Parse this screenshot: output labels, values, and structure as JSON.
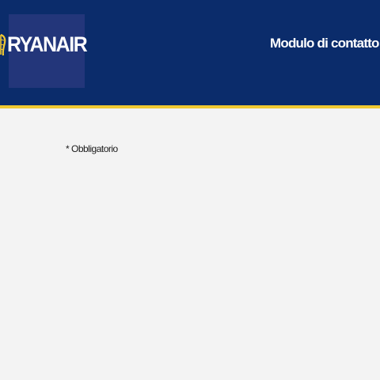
{
  "header": {
    "logo_text": "RYANAIR",
    "title": "Modulo di contatto"
  },
  "form": {
    "required_note": "* Obbligatorio"
  },
  "colors": {
    "header_background": "#0b2c6b",
    "logo_background": "#23367a",
    "accent_stripe": "#f1c931",
    "page_background": "#f3f3f3"
  },
  "icons": {
    "logo_mark": "harp-icon"
  }
}
